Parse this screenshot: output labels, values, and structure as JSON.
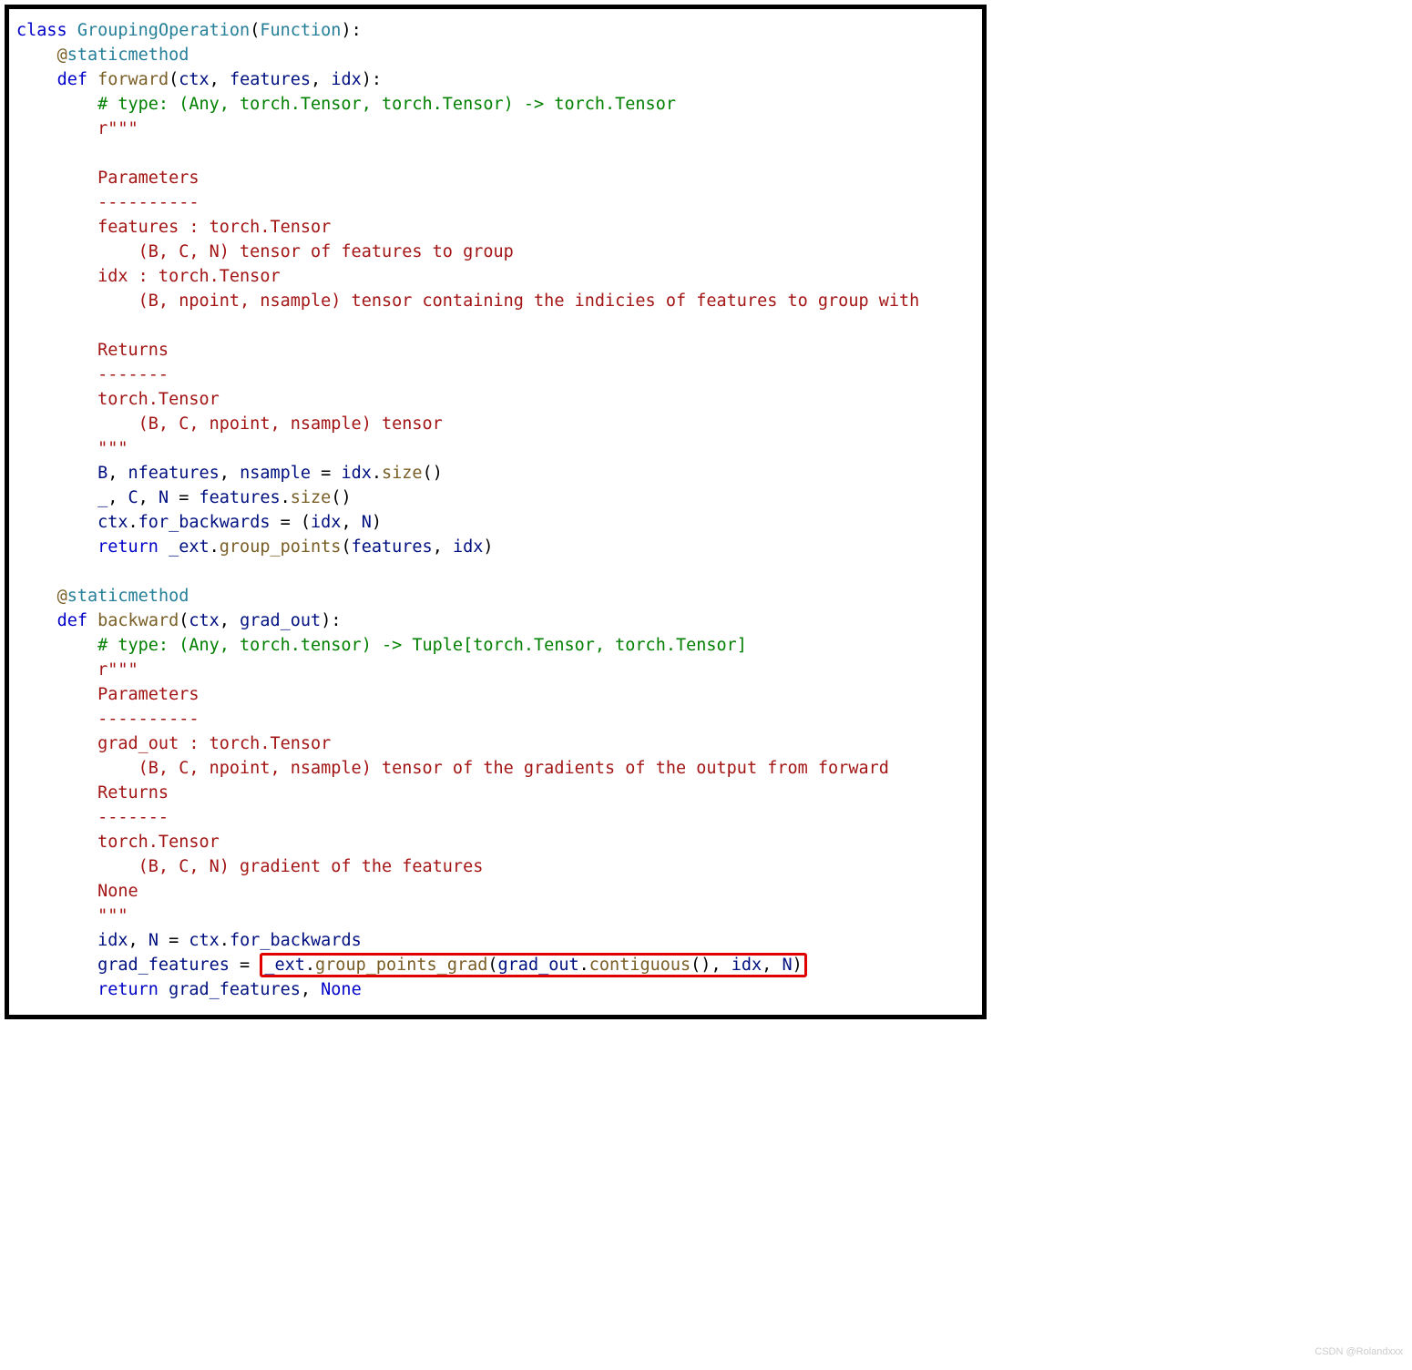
{
  "code": {
    "line01": {
      "kw1": "class",
      "sp1": " ",
      "cls": "GroupingOperation",
      "p1": "(",
      "base": "Function",
      "p2": "):"
    },
    "line02": {
      "indent": "    ",
      "at": "@",
      "dec": "staticmethod"
    },
    "line03": {
      "indent": "    ",
      "kw": "def",
      "sp": " ",
      "fn": "forward",
      "p1": "(",
      "a1": "ctx",
      "c1": ", ",
      "a2": "features",
      "c2": ", ",
      "a3": "idx",
      "p2": "):"
    },
    "line04": {
      "indent": "        ",
      "g": "",
      "cmt": "# type: (Any, torch.Tensor, torch.Tensor) -> torch.Tensor"
    },
    "line05": {
      "indent": "        ",
      "g": "",
      "str": "r\"\"\""
    },
    "line06": {
      "indent": "        ",
      "g": ""
    },
    "line07": {
      "indent": "        ",
      "g": "",
      "str": "Parameters"
    },
    "line08": {
      "indent": "        ",
      "g": "",
      "str": "----------"
    },
    "line09": {
      "indent": "        ",
      "g": "",
      "str": "features : torch.Tensor"
    },
    "line10": {
      "indent": "        ",
      "g": "",
      "g2": "",
      "str": "    (B, C, N) tensor of features to group"
    },
    "line11": {
      "indent": "        ",
      "g": "",
      "str": "idx : torch.Tensor"
    },
    "line12": {
      "indent": "        ",
      "g": "",
      "g2": "",
      "str": "    (B, npoint, nsample) tensor containing the indicies of features to group with"
    },
    "line13": {
      "indent": "        ",
      "g": ""
    },
    "line14": {
      "indent": "        ",
      "g": "",
      "str": "Returns"
    },
    "line15": {
      "indent": "        ",
      "g": "",
      "str": "-------"
    },
    "line16": {
      "indent": "        ",
      "g": "",
      "str": "torch.Tensor"
    },
    "line17": {
      "indent": "        ",
      "g": "",
      "g2": "",
      "str": "    (B, C, npoint, nsample) tensor"
    },
    "line18": {
      "indent": "        ",
      "g": "",
      "str": "\"\"\""
    },
    "line19": {
      "indent": "        ",
      "g": "",
      "v1": "B",
      "c1": ", ",
      "v2": "nfeatures",
      "c2": ", ",
      "v3": "nsample",
      "eq": " = ",
      "v4": "idx",
      "dot": ".",
      "fn": "size",
      "p": "()"
    },
    "line20": {
      "indent": "        ",
      "g": "",
      "v1": "_",
      "c1": ", ",
      "v2": "C",
      "c2": ", ",
      "v3": "N",
      "eq": " = ",
      "v4": "features",
      "dot": ".",
      "fn": "size",
      "p": "()"
    },
    "line21": {
      "indent": "        ",
      "g": "",
      "v1": "ctx",
      "dot": ".",
      "v2": "for_backwards",
      "eq": " = (",
      "v3": "idx",
      "c1": ", ",
      "v4": "N",
      "p": ")"
    },
    "line22": {
      "indent": "        ",
      "g": "",
      "kw": "return",
      "sp": " ",
      "v1": "_ext",
      "dot": ".",
      "fn": "group_points",
      "p1": "(",
      "v2": "features",
      "c1": ", ",
      "v3": "idx",
      "p2": ")"
    },
    "line23": {
      "indent": ""
    },
    "line24": {
      "indent": "    ",
      "at": "@",
      "dec": "staticmethod"
    },
    "line25": {
      "indent": "    ",
      "kw": "def",
      "sp": " ",
      "fn": "backward",
      "p1": "(",
      "a1": "ctx",
      "c1": ", ",
      "a2": "grad_out",
      "p2": "):"
    },
    "line26": {
      "indent": "        ",
      "g": "",
      "cmt": "# type: (Any, torch.tensor) -> Tuple[torch.Tensor, torch.Tensor]"
    },
    "line27": {
      "indent": "        ",
      "g": "",
      "str": "r\"\"\""
    },
    "line28": {
      "indent": "        ",
      "g": "",
      "str": "Parameters"
    },
    "line29": {
      "indent": "        ",
      "g": "",
      "str": "----------"
    },
    "line30": {
      "indent": "        ",
      "g": "",
      "str": "grad_out : torch.Tensor"
    },
    "line31": {
      "indent": "        ",
      "g": "",
      "g2": "",
      "str": "    (B, C, npoint, nsample) tensor of the gradients of the output from forward"
    },
    "line32": {
      "indent": "        ",
      "g": "",
      "str": "Returns"
    },
    "line33": {
      "indent": "        ",
      "g": "",
      "str": "-------"
    },
    "line34": {
      "indent": "        ",
      "g": "",
      "str": "torch.Tensor"
    },
    "line35": {
      "indent": "        ",
      "g": "",
      "g2": "",
      "str": "    (B, C, N) gradient of the features"
    },
    "line36": {
      "indent": "        ",
      "g": "",
      "str": "None"
    },
    "line37": {
      "indent": "        ",
      "g": "",
      "str": "\"\"\""
    },
    "line38": {
      "indent": "        ",
      "g": "",
      "v1": "idx",
      "c1": ", ",
      "v2": "N",
      "eq": " = ",
      "v3": "ctx",
      "dot": ".",
      "v4": "for_backwards"
    },
    "line39": {
      "indent": "        ",
      "g": "",
      "v1": "grad_features",
      "eq": " = ",
      "hl_v": "_ext",
      "hl_dot": ".",
      "hl_fn": "group_points_grad",
      "hl_p1": "(",
      "hl_v2": "grad_out",
      "hl_dot2": ".",
      "hl_fn2": "contiguous",
      "hl_p2": "()",
      "hl_c1": ", ",
      "hl_v3": "idx",
      "hl_c2": ", ",
      "hl_v4": "N",
      "hl_p3": ")"
    },
    "line40": {
      "indent": "        ",
      "g": "",
      "kw": "return",
      "sp": " ",
      "v1": "grad_features",
      "c1": ", ",
      "v2": "None"
    }
  },
  "watermark": "CSDN @Rolandxxx"
}
